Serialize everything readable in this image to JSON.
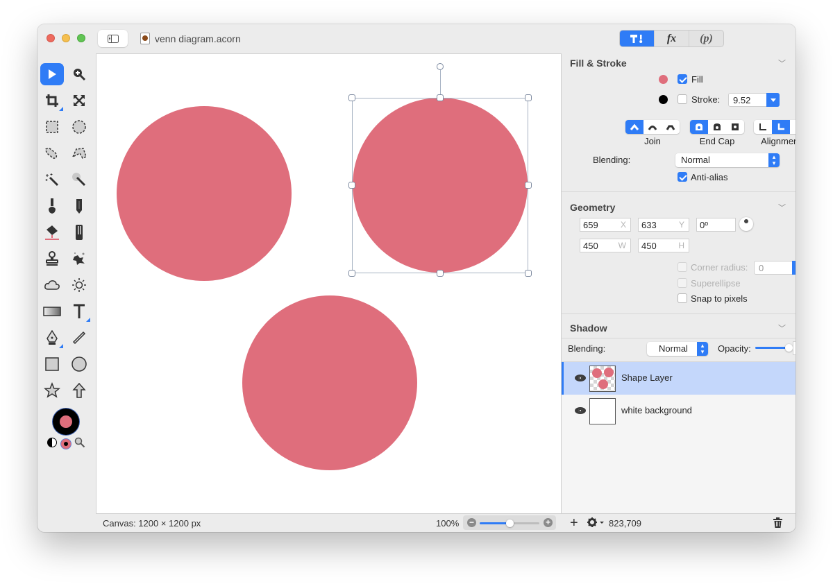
{
  "window": {
    "title": "venn diagram.acorn",
    "mode_tabs": [
      {
        "name": "tools",
        "label": "",
        "active": true
      },
      {
        "name": "filters",
        "label": "fx",
        "active": false
      },
      {
        "name": "plugins",
        "label": "(p)",
        "active": false
      }
    ]
  },
  "toolbox": {
    "tools": [
      "select-arrow",
      "zoom",
      "crop",
      "transform",
      "rect-select",
      "ellipse-select",
      "lasso-select",
      "polygon-lasso",
      "magic-wand",
      "instant-alpha",
      "brush",
      "pencil",
      "paint-bucket",
      "eraser",
      "clone-stamp",
      "smudge",
      "cloud",
      "sun-burn",
      "gradient",
      "text",
      "pen",
      "line",
      "rectangle",
      "oval",
      "star",
      "arrow"
    ],
    "active_tool": "select-arrow",
    "stroke_color": "#000000",
    "fill_color": "#df6e7c"
  },
  "canvas": {
    "shape_color": "#df6e7c",
    "status": "Canvas: 1200 × 1200 px",
    "zoom_label": "100%",
    "zoom_fraction": 0.5
  },
  "inspector": {
    "fill_stroke": {
      "title": "Fill & Stroke",
      "fill_label": "Fill",
      "fill_checked": true,
      "fill_color": "#df6e7c",
      "stroke_label": "Stroke:",
      "stroke_checked": false,
      "stroke_color": "#000000",
      "stroke_width": "9.52",
      "join_label": "Join",
      "endcap_label": "End Cap",
      "alignment_label": "Alignment",
      "blending_label": "Blending:",
      "blending_value": "Normal",
      "antialias_label": "Anti-alias",
      "antialias_checked": true
    },
    "geometry": {
      "title": "Geometry",
      "x": "659",
      "x_unit": "X",
      "y": "633",
      "y_unit": "Y",
      "angle": "0º",
      "w": "450",
      "w_unit": "W",
      "h": "450",
      "h_unit": "H",
      "corner_radius_label": "Corner radius:",
      "corner_radius_value": "0",
      "superellipse_label": "Superellipse",
      "snap_label": "Snap to pixels"
    },
    "shadow": {
      "title": "Shadow",
      "blending_label": "Blending:",
      "blending_value": "Normal",
      "opacity_label": "Opacity:",
      "opacity_value": "100%",
      "opacity_fraction": 1.0
    },
    "layers": [
      {
        "name": "Shape Layer",
        "selected": true,
        "visible": true
      },
      {
        "name": "white background",
        "selected": false,
        "visible": true
      }
    ],
    "coords": "823,709"
  }
}
